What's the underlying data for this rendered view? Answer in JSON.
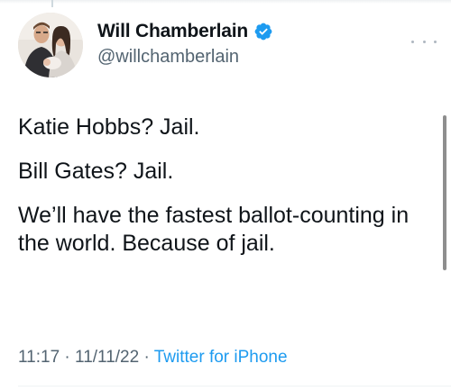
{
  "tweet": {
    "author": {
      "display_name": "Will Chamberlain",
      "handle": "@willchamberlain",
      "verified": true,
      "avatar_icon": "profile-photo-couple"
    },
    "more_icon": "more-dots-icon",
    "body": [
      "Katie Hobbs? Jail.",
      "Bill Gates? Jail.",
      "We’ll have the fastest ballot-counting in the world. Because of jail."
    ],
    "meta": {
      "time": "11:17",
      "separator": "·",
      "date": "11/11/22",
      "source": "Twitter for iPhone"
    }
  },
  "colors": {
    "text_primary": "#0f1419",
    "text_secondary": "#536471",
    "link": "#1d9bf0",
    "verified_badge": "#1d9bf0"
  }
}
